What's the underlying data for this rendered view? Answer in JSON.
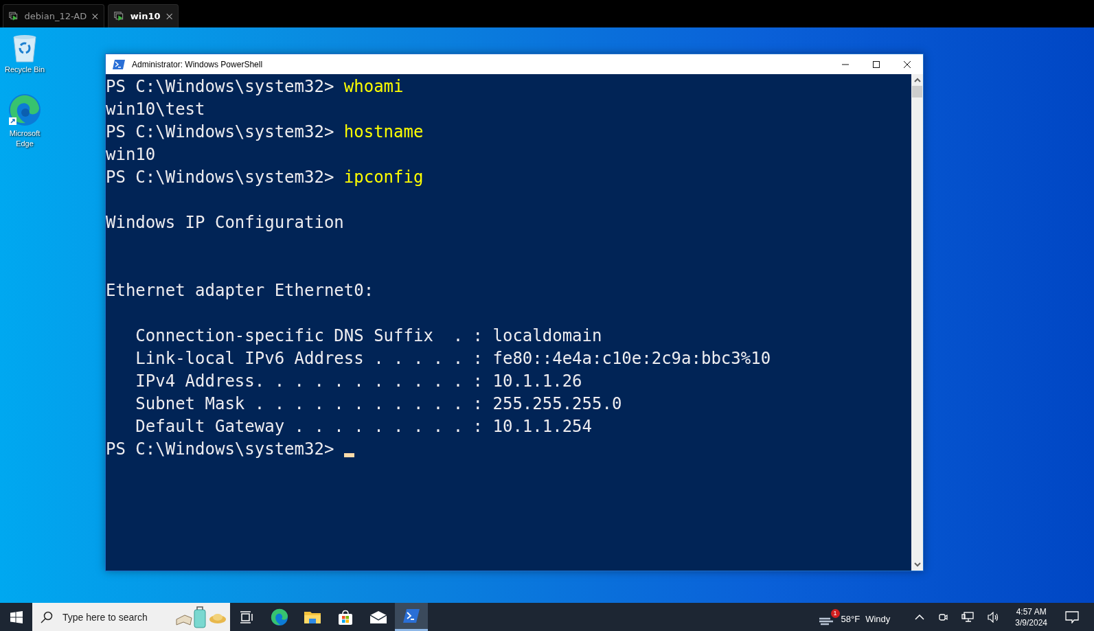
{
  "vm_tabs": [
    {
      "label": "debian_12-AD",
      "selected": false
    },
    {
      "label": "win10",
      "selected": true
    }
  ],
  "desktop_icons": [
    {
      "kind": "recycle",
      "label": "Recycle Bin"
    },
    {
      "kind": "edge",
      "label": "Microsoft Edge"
    }
  ],
  "window": {
    "title": "Administrator: Windows PowerShell"
  },
  "terminal": {
    "lines": [
      {
        "kind": "prompt",
        "prompt": "PS C:\\Windows\\system32> ",
        "command": "whoami"
      },
      {
        "kind": "output",
        "text": "win10\\test"
      },
      {
        "kind": "prompt",
        "prompt": "PS C:\\Windows\\system32> ",
        "command": "hostname"
      },
      {
        "kind": "output",
        "text": "win10"
      },
      {
        "kind": "prompt",
        "prompt": "PS C:\\Windows\\system32> ",
        "command": "ipconfig"
      },
      {
        "kind": "blank"
      },
      {
        "kind": "output",
        "text": "Windows IP Configuration"
      },
      {
        "kind": "blank"
      },
      {
        "kind": "blank"
      },
      {
        "kind": "output",
        "text": "Ethernet adapter Ethernet0:"
      },
      {
        "kind": "blank"
      },
      {
        "kind": "output",
        "text": "   Connection-specific DNS Suffix  . : localdomain"
      },
      {
        "kind": "output",
        "text": "   Link-local IPv6 Address . . . . . : fe80::4e4a:c10e:2c9a:bbc3%10"
      },
      {
        "kind": "output",
        "text": "   IPv4 Address. . . . . . . . . . . : 10.1.1.26"
      },
      {
        "kind": "output",
        "text": "   Subnet Mask . . . . . . . . . . . : 255.255.255.0"
      },
      {
        "kind": "output",
        "text": "   Default Gateway . . . . . . . . . : 10.1.1.254"
      },
      {
        "kind": "cursor",
        "prompt": "PS C:\\Windows\\system32> "
      }
    ]
  },
  "taskbar": {
    "search": {
      "placeholder": "Type here to search"
    },
    "apps": [
      {
        "kind": "taskview",
        "selected": false
      },
      {
        "kind": "edge",
        "selected": false
      },
      {
        "kind": "explorer",
        "selected": false
      },
      {
        "kind": "store",
        "selected": false
      },
      {
        "kind": "mail",
        "selected": false
      },
      {
        "kind": "powershell",
        "selected": true
      }
    ],
    "weather": {
      "badge": "1",
      "temperature": "58°F",
      "condition": "Windy"
    },
    "clock": {
      "time": "4:57 AM",
      "date": "3/9/2024"
    }
  }
}
